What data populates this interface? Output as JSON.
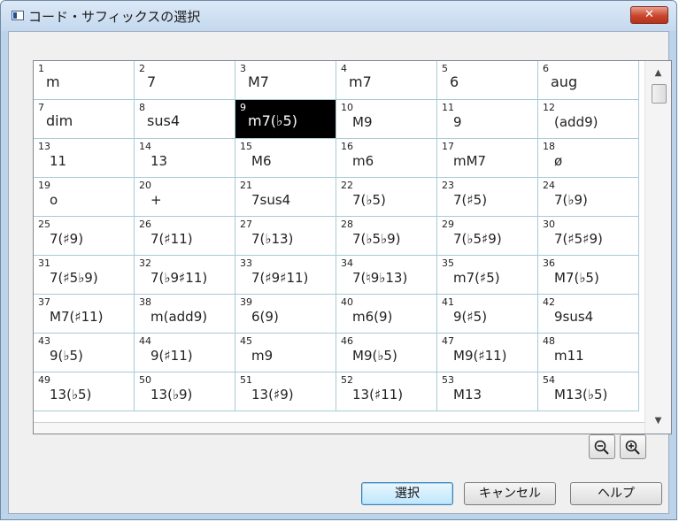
{
  "window": {
    "title": "コード・サフィックスの選択",
    "close_label": "✕"
  },
  "grid": {
    "selected_index": 9,
    "cells": [
      {
        "num": "1",
        "sym": "m"
      },
      {
        "num": "2",
        "sym": "7"
      },
      {
        "num": "3",
        "sym": "M7"
      },
      {
        "num": "4",
        "sym": "m7"
      },
      {
        "num": "5",
        "sym": "6"
      },
      {
        "num": "6",
        "sym": "aug"
      },
      {
        "num": "7",
        "sym": "dim"
      },
      {
        "num": "8",
        "sym": "sus4"
      },
      {
        "num": "9",
        "sym": "m7(♭5)"
      },
      {
        "num": "10",
        "sym": "M9"
      },
      {
        "num": "11",
        "sym": "9"
      },
      {
        "num": "12",
        "sym": "(add9)"
      },
      {
        "num": "13",
        "sym": "11"
      },
      {
        "num": "14",
        "sym": "13"
      },
      {
        "num": "15",
        "sym": "M6"
      },
      {
        "num": "16",
        "sym": "m6"
      },
      {
        "num": "17",
        "sym": "mM7"
      },
      {
        "num": "18",
        "sym": "ø"
      },
      {
        "num": "19",
        "sym": "o"
      },
      {
        "num": "20",
        "sym": "+"
      },
      {
        "num": "21",
        "sym": "7sus4"
      },
      {
        "num": "22",
        "sym": "7(♭5)"
      },
      {
        "num": "23",
        "sym": "7(♯5)"
      },
      {
        "num": "24",
        "sym": "7(♭9)"
      },
      {
        "num": "25",
        "sym": "7(♯9)"
      },
      {
        "num": "26",
        "sym": "7(♯11)"
      },
      {
        "num": "27",
        "sym": "7(♭13)"
      },
      {
        "num": "28",
        "sym": "7(♭5♭9)"
      },
      {
        "num": "29",
        "sym": "7(♭5♯9)"
      },
      {
        "num": "30",
        "sym": "7(♯5♯9)"
      },
      {
        "num": "31",
        "sym": "7(♯5♭9)"
      },
      {
        "num": "32",
        "sym": "7(♭9♯11)"
      },
      {
        "num": "33",
        "sym": "7(♯9♯11)"
      },
      {
        "num": "34",
        "sym": "7(♮9♭13)"
      },
      {
        "num": "35",
        "sym": "m7(♯5)"
      },
      {
        "num": "36",
        "sym": "M7(♭5)"
      },
      {
        "num": "37",
        "sym": "M7(♯11)"
      },
      {
        "num": "38",
        "sym": "m(add9)"
      },
      {
        "num": "39",
        "sym": "6(9)"
      },
      {
        "num": "40",
        "sym": "m6(9)"
      },
      {
        "num": "41",
        "sym": "9(♯5)"
      },
      {
        "num": "42",
        "sym": "9sus4"
      },
      {
        "num": "43",
        "sym": "9(♭5)"
      },
      {
        "num": "44",
        "sym": "9(♯11)"
      },
      {
        "num": "45",
        "sym": "m9"
      },
      {
        "num": "46",
        "sym": "M9(♭5)"
      },
      {
        "num": "47",
        "sym": "M9(♯11)"
      },
      {
        "num": "48",
        "sym": "m11"
      },
      {
        "num": "49",
        "sym": "13(♭5)"
      },
      {
        "num": "50",
        "sym": "13(♭9)"
      },
      {
        "num": "51",
        "sym": "13(♯9)"
      },
      {
        "num": "52",
        "sym": "13(♯11)"
      },
      {
        "num": "53",
        "sym": "M13"
      },
      {
        "num": "54",
        "sym": "M13(♭5)"
      }
    ]
  },
  "scrollbar": {
    "up_icon": "▲",
    "down_icon": "▼"
  },
  "buttons": {
    "select": "選択",
    "cancel": "キャンセル",
    "help": "ヘルプ"
  },
  "icons": {
    "zoom_out": "zoom-out-icon",
    "zoom_in": "zoom-in-icon"
  }
}
